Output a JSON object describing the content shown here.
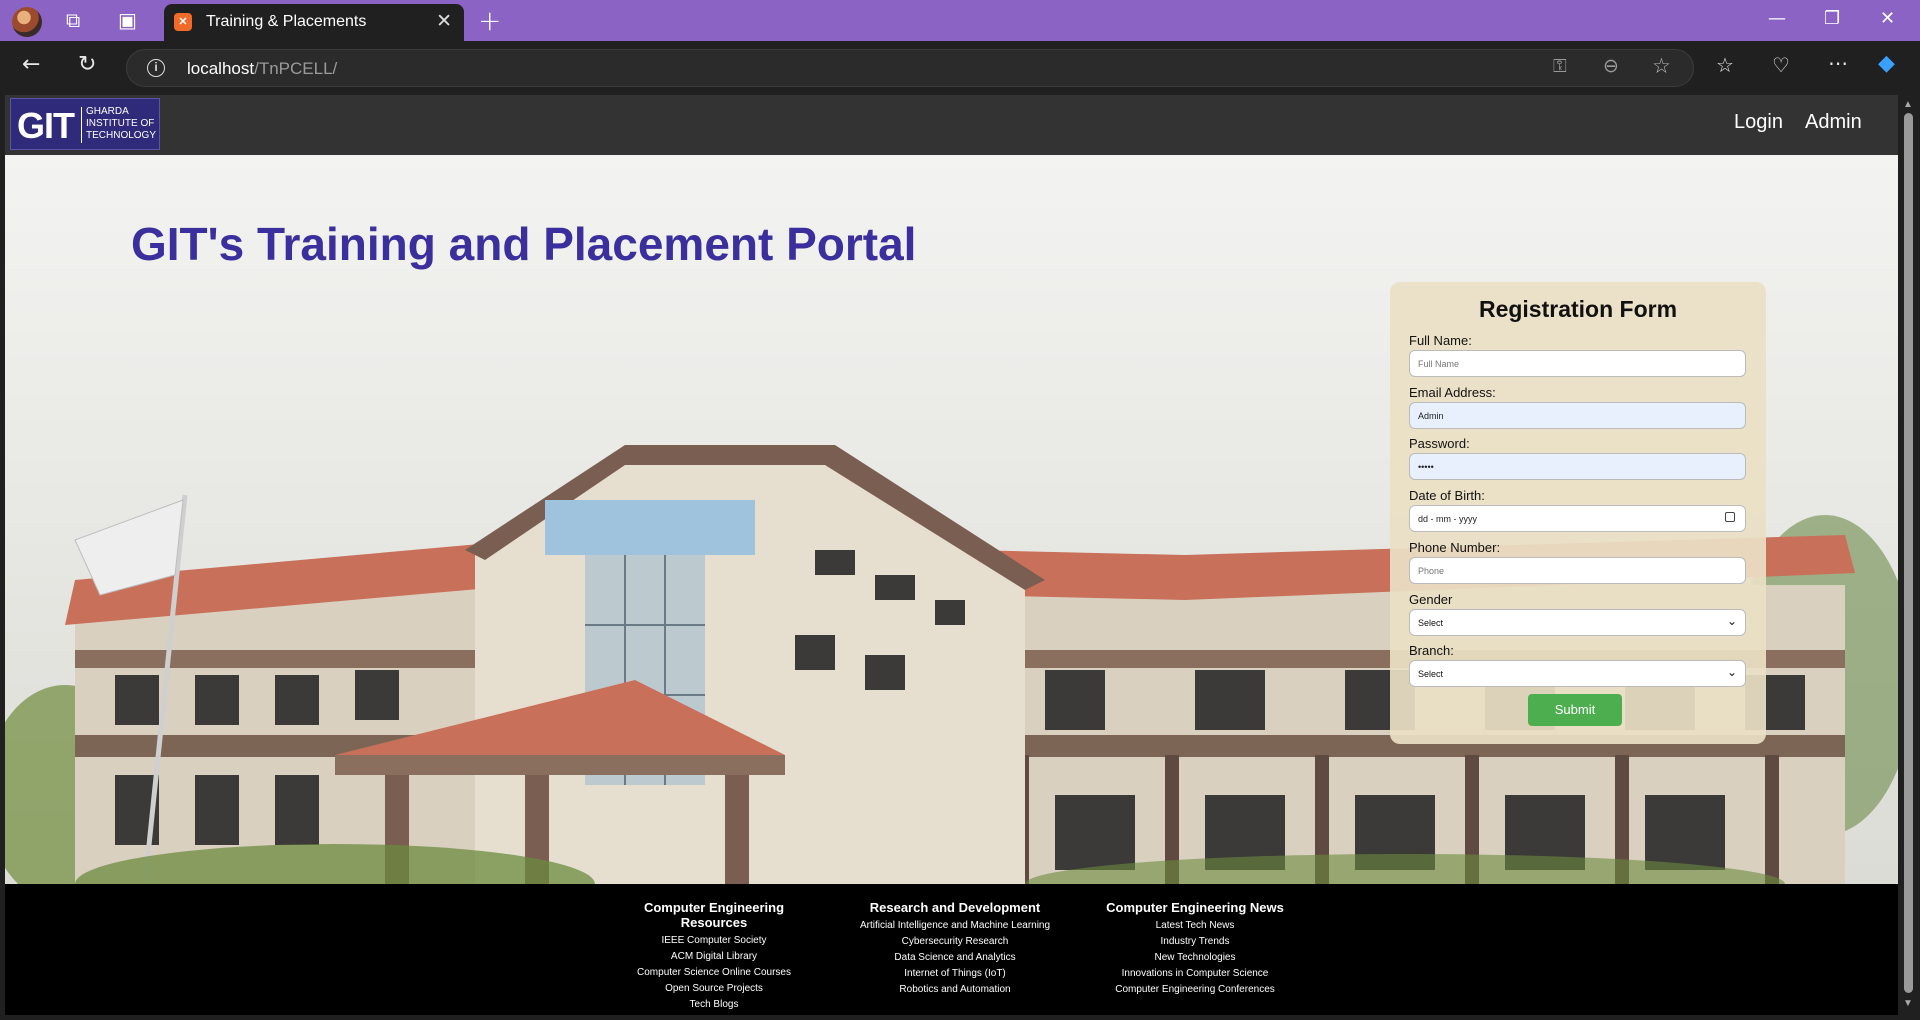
{
  "browser": {
    "tab_title": "Training & Placements",
    "url_host": "localhost",
    "url_path": "/TnPCELL/"
  },
  "site": {
    "logo": {
      "main": "GIT",
      "sub": "GHARDA INSTITUTE OF TECHNOLOGY"
    },
    "nav": {
      "login": "Login",
      "admin": "Admin"
    },
    "hero_title": "GIT's Training and Placement Portal"
  },
  "form": {
    "title": "Registration Form",
    "fullname_label": "Full Name:",
    "fullname_placeholder": "Full Name",
    "email_label": "Email Address:",
    "email_value": "Admin",
    "password_label": "Password:",
    "password_value": "•••••",
    "dob_label": "Date of Birth:",
    "dob_placeholder": "dd - mm - yyyy",
    "phone_label": "Phone Number:",
    "phone_placeholder": "Phone",
    "gender_label": "Gender",
    "gender_value": "Select",
    "branch_label": "Branch:",
    "branch_value": "Select",
    "submit": "Submit"
  },
  "footer": {
    "columns": [
      {
        "heading": "Computer Engineering Resources",
        "links": [
          "IEEE Computer Society",
          "ACM Digital Library",
          "Computer Science Online Courses",
          "Open Source Projects",
          "Tech Blogs"
        ]
      },
      {
        "heading": "Research and Development",
        "links": [
          "Artificial Intelligence and Machine Learning",
          "Cybersecurity Research",
          "Data Science and Analytics",
          "Internet of Things (IoT)",
          "Robotics and Automation"
        ]
      },
      {
        "heading": "Computer Engineering News",
        "links": [
          "Latest Tech News",
          "Industry Trends",
          "New Technologies",
          "Innovations in Computer Science",
          "Computer Engineering Conferences"
        ]
      }
    ]
  },
  "colors": {
    "tabbar": "#8a63c4",
    "site_nav": "#333333",
    "hero_title": "#3a2f9c",
    "submit": "#4cae4f",
    "form_bg": "#eae0c4"
  }
}
